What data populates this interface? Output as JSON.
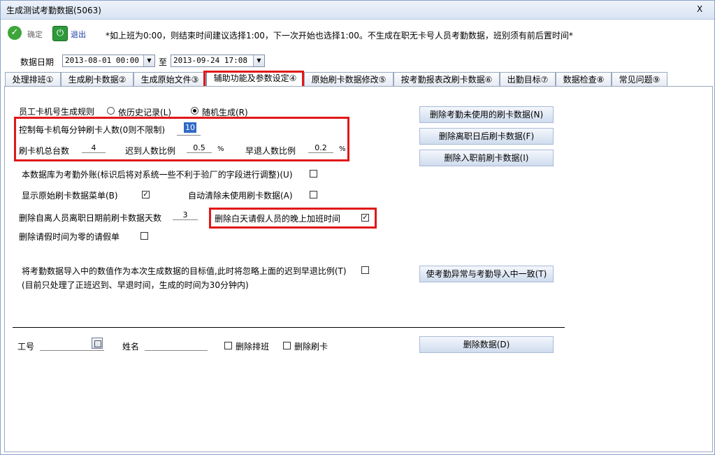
{
  "window": {
    "title": "生成测试考勤数据(5063)",
    "close": "X"
  },
  "toolbar": {
    "ok_label": "确定",
    "exit_label": "退出",
    "notice": "*如上班为0:00，则结束时间建议选择1:00，下一次开始也选择1:00。不生成在职无卡号人员考勤数据，班别须有前后置时间*"
  },
  "date_range": {
    "label": "数据日期",
    "start": "2013-08-01 00:00",
    "separator": "至",
    "end": "2013-09-24 17:08"
  },
  "tabs": [
    "处理排班①",
    "生成刷卡数据②",
    "生成原始文件③",
    "辅助功能及参数设定④",
    "原始刷卡数据修改⑤",
    "按考勤报表改刷卡数据⑥",
    "出勤目标⑦",
    "数据检查⑧",
    "常见问题⑨"
  ],
  "active_tab": "辅助功能及参数设定④",
  "card_rule": {
    "label": "员工卡机号生成规则",
    "option1": "依历史记录(L)",
    "option2": "随机生成(R)",
    "selected": "随机生成(R)"
  },
  "per_minute": {
    "label": "控制每卡机每分钟刷卡人数(0则不限制)",
    "value": "10"
  },
  "machines": {
    "total_label": "刷卡机总台数",
    "total_value": "4",
    "late_label": "迟到人数比例",
    "late_value": "0.5",
    "late_unit": "%",
    "early_label": "早退人数比例",
    "early_value": "0.2",
    "early_unit": "%"
  },
  "options": {
    "external_db": "本数据库为考勤外账(标识后将对系统一些不利于验厂的字段进行调整)(U)",
    "show_raw_menu": "显示原始刷卡数据菜单(B)",
    "auto_clear": "自动清除未使用刷卡数据(A)",
    "delete_days_label": "删除自离人员离职日期前刷卡数据天数",
    "delete_days_value": "3",
    "delete_overtime": "删除白天请假人员的晚上加班时间",
    "delete_zero_leave": "删除请假时间为零的请假单"
  },
  "import_target": {
    "line1": "将考勤数据导入中的数值作为本次生成数据的目标值,此时将忽略上面的迟到早退比例(T)",
    "line2": "(目前只处理了正班迟到、早退时间，生成的时间为30分钟内)"
  },
  "buttons": {
    "delete_unused": "删除考勤未使用的刷卡数据(N)",
    "delete_after_leave": "删除离职日后刷卡数据(F)",
    "delete_before_join": "删除入职前刷卡数据(I)",
    "sync_import": "使考勤异常与考勤导入中一致(T)",
    "delete_data": "删除数据(D)"
  },
  "bottom": {
    "emp_no_label": "工号",
    "name_label": "姓名",
    "del_schedule": "删除排班",
    "del_punch": "删除刷卡"
  },
  "colors": {
    "highlight": "#e01818",
    "title_bg": "#d8e3f3"
  }
}
